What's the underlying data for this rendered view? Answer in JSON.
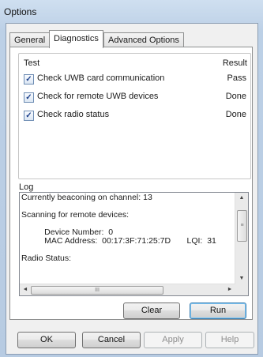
{
  "window": {
    "title": "Options"
  },
  "tabs": [
    {
      "label": "General"
    },
    {
      "label": "Diagnostics"
    },
    {
      "label": "Advanced Options"
    }
  ],
  "diagnostics": {
    "test_header": "Test",
    "result_header": "Result",
    "tests": [
      {
        "label": "Check UWB card communication",
        "checked": true,
        "result": "Pass"
      },
      {
        "label": "Check for remote UWB devices",
        "checked": true,
        "result": "Done"
      },
      {
        "label": "Check radio status",
        "checked": true,
        "result": "Done"
      }
    ],
    "log_label": "Log",
    "log_text": "Currently beaconing on channel: 13\n\nScanning for remote devices:\n\n          Device Number:  0\n          MAC Address:  00:17:3F:71:25:7D       LQI:  31\n\nRadio Status:",
    "scroll": {
      "up": "▲",
      "down": "▼",
      "left": "◄",
      "right": "►",
      "grip_v": "≡",
      "grip_h": "III"
    },
    "clear_label": "Clear",
    "run_label": "Run"
  },
  "footer": {
    "ok_label": "OK",
    "cancel_label": "Cancel",
    "apply_label": "Apply",
    "help_label": "Help"
  }
}
